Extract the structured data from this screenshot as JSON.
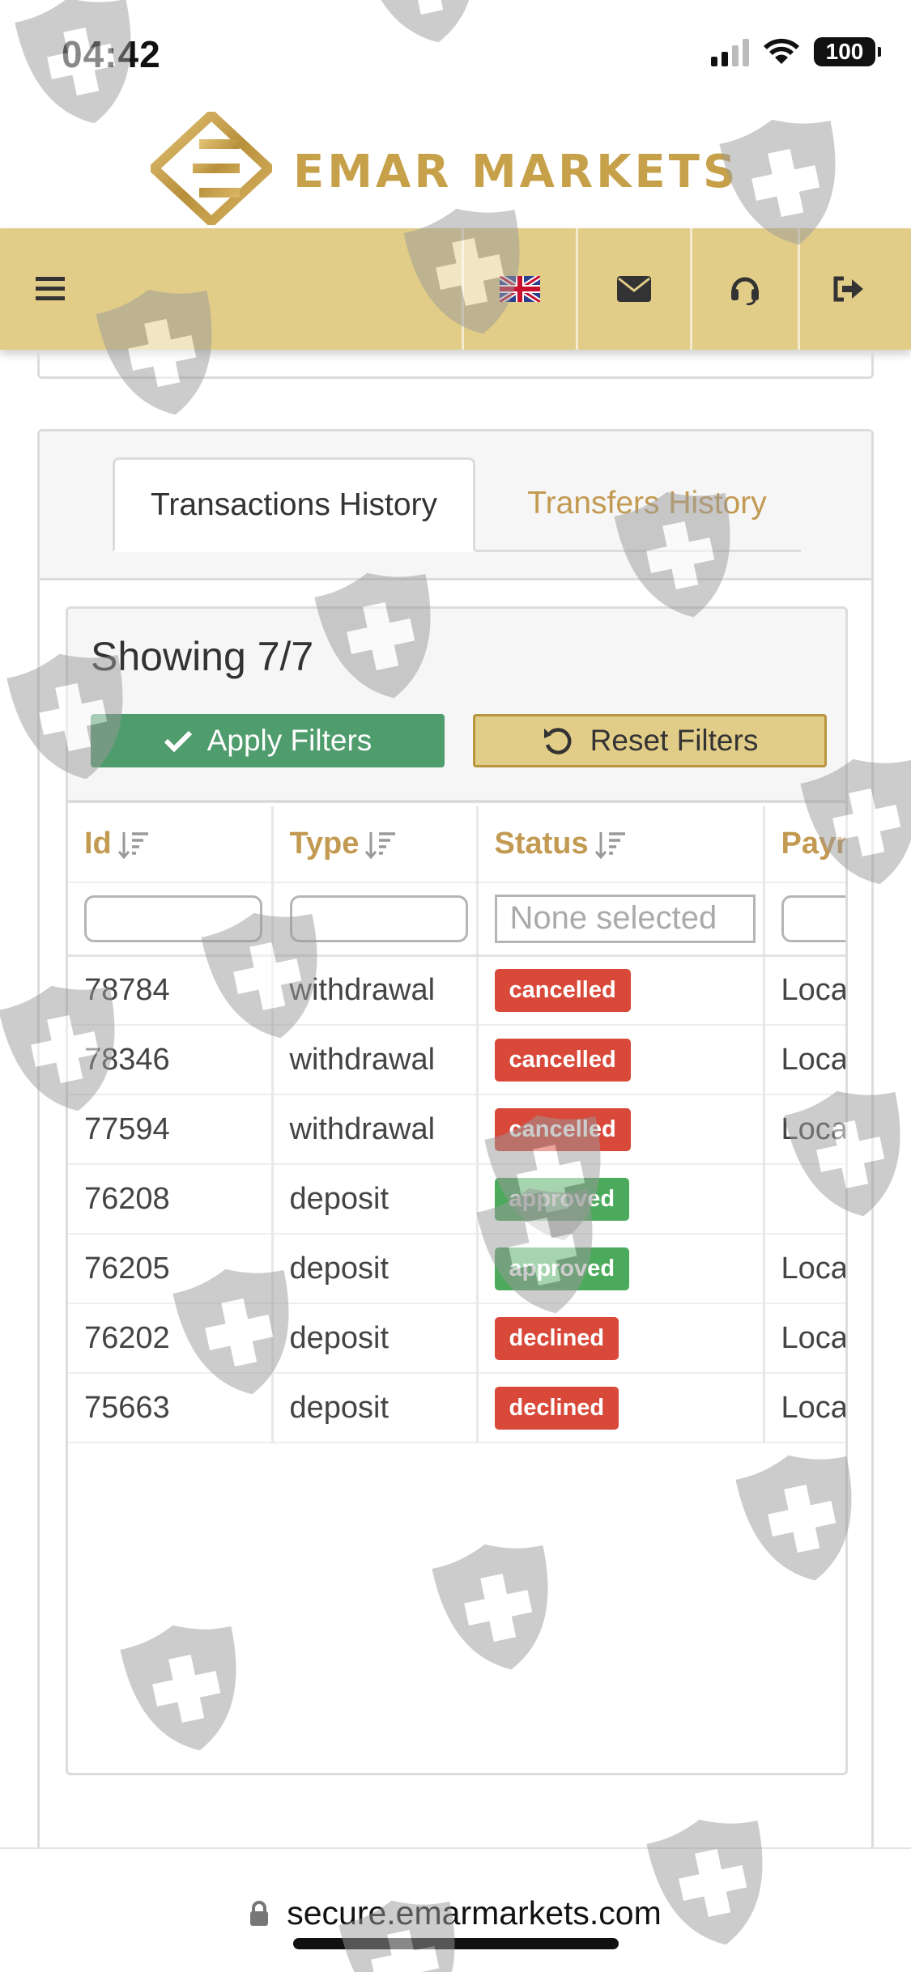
{
  "status_bar": {
    "time": "04:42",
    "battery": "100"
  },
  "brand": {
    "name": "EMAR MARKETS",
    "color": "#c7a14a"
  },
  "navbar": {
    "items": [
      {
        "icon": "hamburger-menu-icon"
      },
      {
        "icon": "uk-flag-icon"
      },
      {
        "icon": "envelope-icon"
      },
      {
        "icon": "headset-support-icon"
      },
      {
        "icon": "sign-out-icon"
      }
    ],
    "color": "#e2cd88"
  },
  "tabs": [
    {
      "label": "Transactions History",
      "active": true
    },
    {
      "label": "Transfers History",
      "active": false
    }
  ],
  "results": {
    "showing": "Showing 7/7",
    "apply_label": "Apply Filters",
    "reset_label": "Reset Filters"
  },
  "table": {
    "columns": [
      "Id",
      "Type",
      "Status",
      "Payr"
    ],
    "status_filter_placeholder": "None selected",
    "rows": [
      {
        "id": "78784",
        "type": "withdrawal",
        "status": "cancelled",
        "payment": "Loca"
      },
      {
        "id": "78346",
        "type": "withdrawal",
        "status": "cancelled",
        "payment": "Loca"
      },
      {
        "id": "77594",
        "type": "withdrawal",
        "status": "cancelled",
        "payment": "Loca"
      },
      {
        "id": "76208",
        "type": "deposit",
        "status": "approved",
        "payment": ""
      },
      {
        "id": "76205",
        "type": "deposit",
        "status": "approved",
        "payment": "Loca"
      },
      {
        "id": "76202",
        "type": "deposit",
        "status": "declined",
        "payment": "Loca"
      },
      {
        "id": "75663",
        "type": "deposit",
        "status": "declined",
        "payment": "Loca"
      }
    ]
  },
  "status_colors": {
    "cancelled": "#d9493a",
    "declined": "#d9493a",
    "approved": "#4caa5c"
  },
  "browser": {
    "url": "secure.emarmarkets.com"
  }
}
